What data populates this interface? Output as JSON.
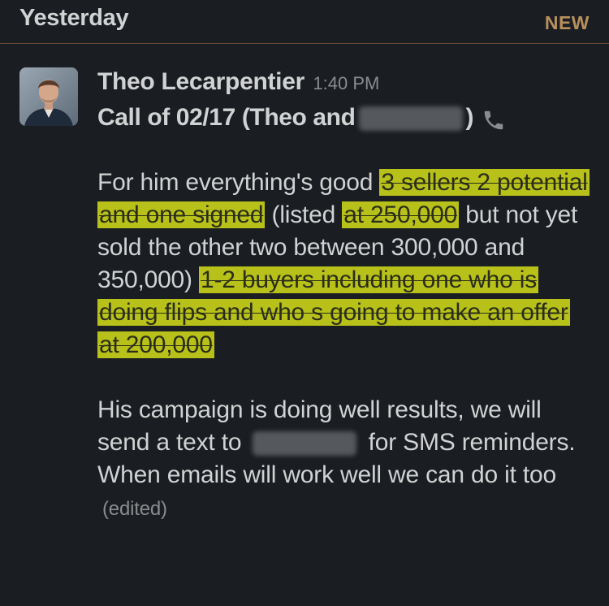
{
  "header": {
    "day_label": "Yesterday",
    "new_label": "NEW"
  },
  "message": {
    "sender": "Theo Lecarpentier",
    "time": "1:40 PM",
    "subject_prefix": "Call of 02/17 (Theo and",
    "subject_suffix": ")",
    "subject_icon": "phone-icon",
    "paragraph1": [
      {
        "text": "For him everything's good ",
        "highlight": false
      },
      {
        "text": "3 sellers 2 potential and one signed",
        "highlight": true
      },
      {
        "text": " (listed ",
        "highlight": false
      },
      {
        "text": "at 250,000",
        "highlight": true
      },
      {
        "text": " but not yet sold the other two between 300,000 and 350,000) ",
        "highlight": false
      },
      {
        "text": "1-2 buyers including one who is doing flips and who s going to make an offer at 200,000",
        "highlight": true
      }
    ],
    "paragraph2_before": "His campaign is doing well results, we will send a text to",
    "paragraph2_after": "for SMS reminders. When emails will work well we can do it too",
    "edited_label": "(edited)"
  },
  "colors": {
    "background": "#1a1d21",
    "text": "#d1d2d3",
    "highlight": "#b8c11a",
    "new_accent": "#b8905d"
  }
}
